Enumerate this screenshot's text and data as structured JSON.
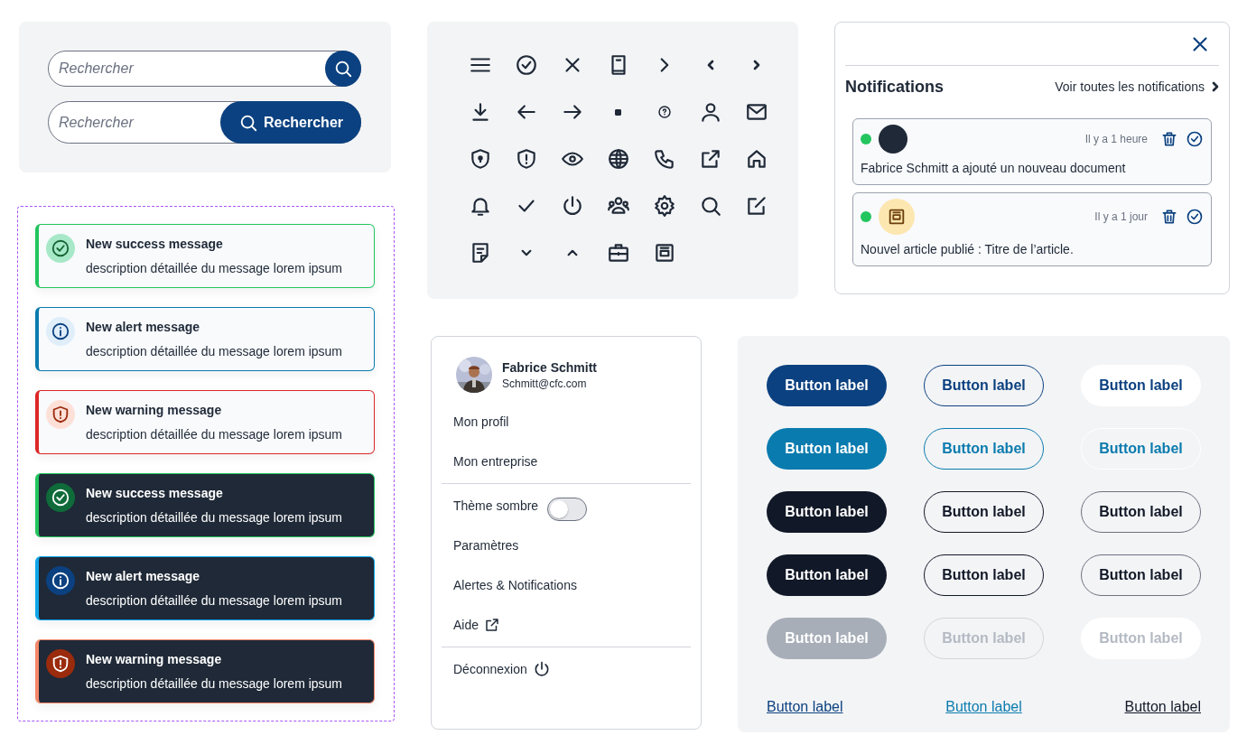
{
  "search_fields": [
    {
      "kind": "icon-button",
      "placeholder": "Rechercher"
    },
    {
      "kind": "text-button",
      "placeholder": "Rechercher",
      "button_label": "Rechercher"
    }
  ],
  "light_toasts": [
    {
      "kind": "success",
      "title": "New success message",
      "description": "description détaillée du message lorem ipsum"
    },
    {
      "kind": "alert",
      "title": "New alert message",
      "description": "description détaillée du message lorem ipsum"
    },
    {
      "kind": "warning",
      "title": "New warning message",
      "description": "description détaillée du message lorem ipsum"
    }
  ],
  "dark_toasts": [
    {
      "kind": "success",
      "title": "New success message",
      "description": "description détaillée du message lorem ipsum"
    },
    {
      "kind": "alert",
      "title": "New alert message",
      "description": "description détaillée du message lorem ipsum"
    },
    {
      "kind": "warning",
      "title": "New warning message",
      "description": "description détaillée du message lorem ipsum"
    }
  ],
  "notifications": {
    "title": "Notifications",
    "link": "Voir toutes les notifications",
    "items": [
      {
        "kind": "person",
        "unread": true,
        "time": "Il y a 1 heure",
        "text": "Fabrice Schmitt a ajouté un nouveau document"
      },
      {
        "kind": "article",
        "unread": true,
        "time": "Il y a 1 jour",
        "text": "Nouvel article publié : Titre de l’article."
      }
    ]
  },
  "user_menu": {
    "name": "Fabrice Schmitt",
    "email": "Schmitt@cfc.com",
    "items": [
      {
        "kind": "link",
        "label": "Mon profil"
      },
      {
        "kind": "link",
        "label": "Mon entreprise"
      },
      {
        "kind": "divider"
      },
      {
        "kind": "toggle",
        "label": "Thème sombre",
        "on": false
      },
      {
        "kind": "link",
        "label": "Paramètres"
      },
      {
        "kind": "link",
        "label": "Alertes & Notifications"
      },
      {
        "kind": "external",
        "label": "Aide"
      },
      {
        "kind": "divider"
      },
      {
        "kind": "logout",
        "label": "Déconnexion"
      }
    ]
  },
  "button_rows": [
    {
      "disabled": false,
      "buttons": [
        "Button label",
        "Button label",
        "Button label"
      ]
    },
    {
      "disabled": false,
      "buttons": [
        "Button label",
        "Button label",
        "Button label"
      ]
    },
    {
      "disabled": false,
      "buttons": [
        "Button label",
        "Button label",
        "Button label"
      ]
    },
    {
      "disabled": false,
      "buttons": [
        "Button label",
        "Button label",
        "Button label"
      ]
    },
    {
      "disabled": true,
      "buttons": [
        "Button label",
        "Button label",
        "Button label"
      ]
    }
  ],
  "link_buttons": [
    "Button label",
    "Button label",
    "Button label"
  ]
}
